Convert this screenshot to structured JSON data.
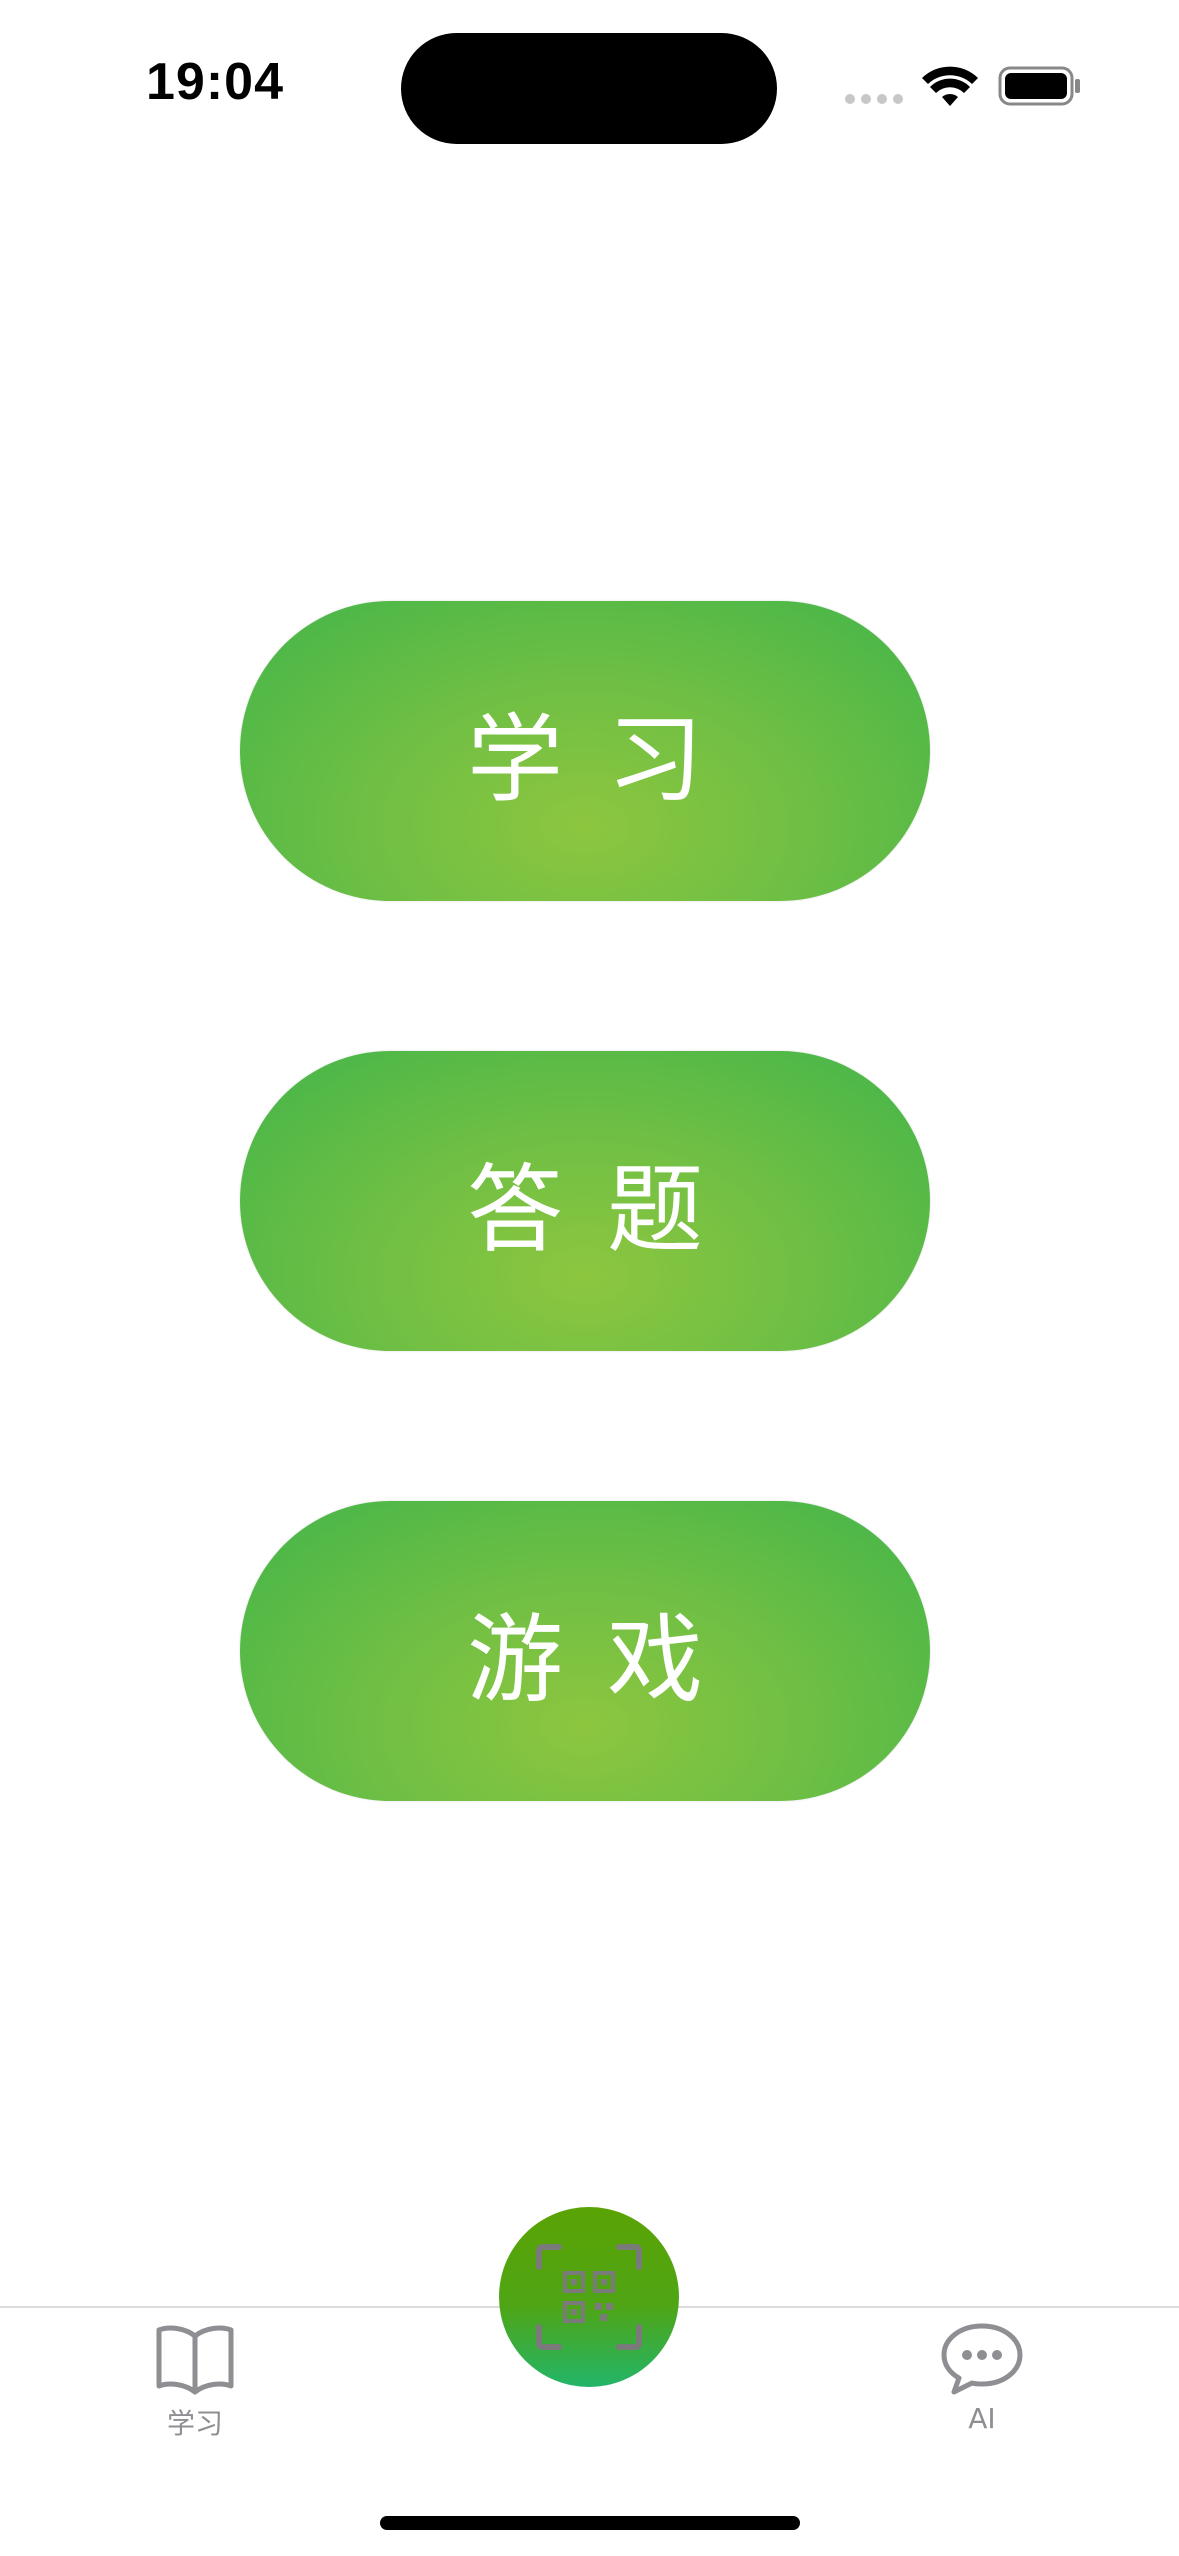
{
  "status_bar": {
    "time": "19:04"
  },
  "main": {
    "buttons": [
      {
        "label": "学习"
      },
      {
        "label": "答题"
      },
      {
        "label": "游戏"
      }
    ]
  },
  "tab_bar": {
    "items": [
      {
        "label": "学习",
        "icon": "book-icon"
      },
      {
        "label": "AI",
        "icon": "chat-bubble-icon"
      }
    ],
    "center_action_icon": "qr-scan-icon"
  },
  "colors": {
    "pill_center": "#8dc63f",
    "pill_edge": "#42b549",
    "scan_top": "#5aa304",
    "scan_bottom": "#23b569",
    "tab_inactive": "#8e8e93"
  }
}
